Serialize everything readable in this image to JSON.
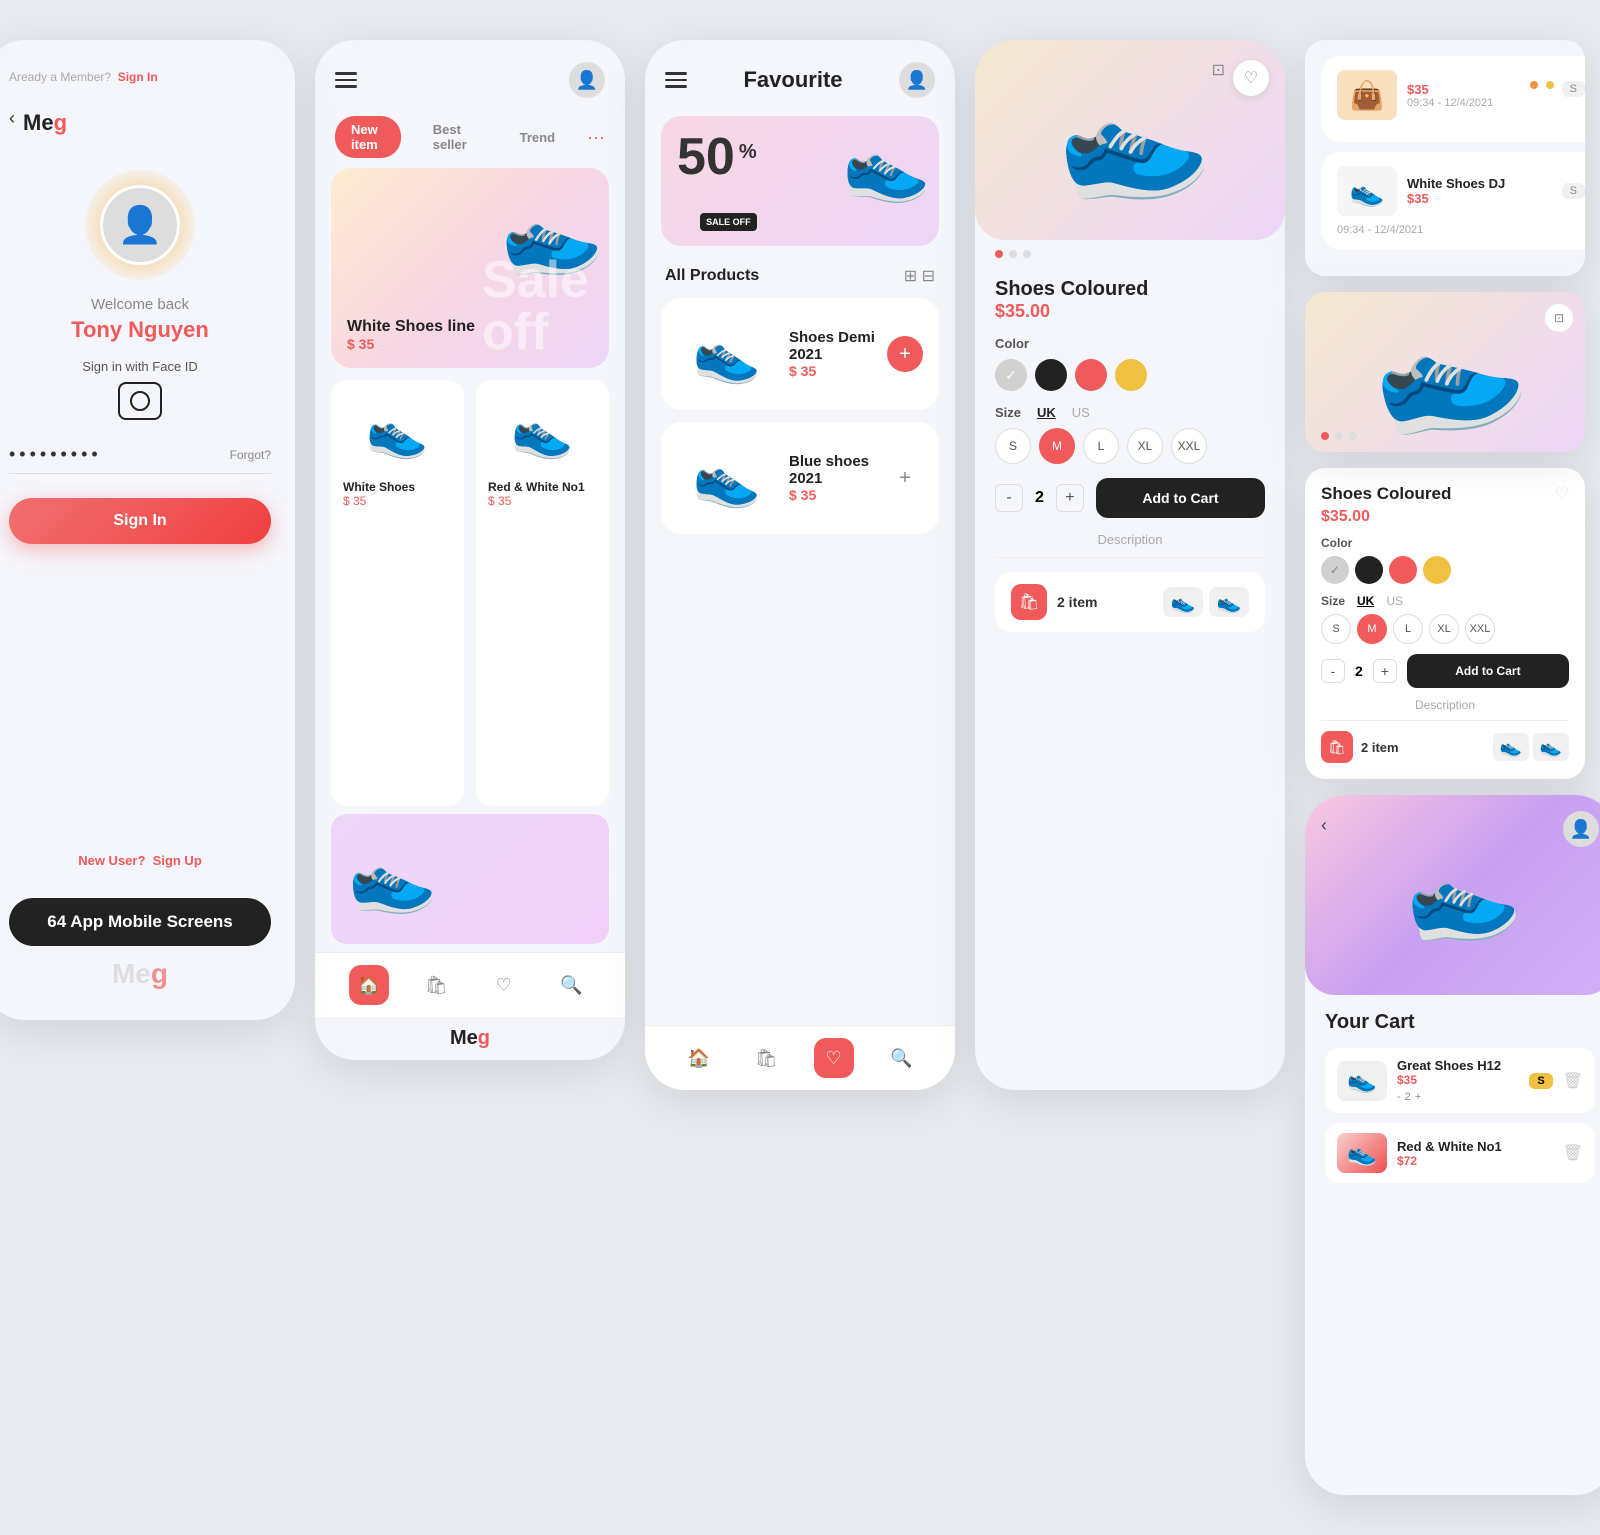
{
  "app": {
    "brand": "Meg",
    "brand_accent": "g",
    "badge_64": "64 App Mobile Screens"
  },
  "screen_login": {
    "back_icon": "‹",
    "already_member": "Aready a Member?",
    "sign_in_link": "Sign In",
    "welcome": "Welcome back",
    "user_name": "Tony Nguyen",
    "face_id_label": "Sign in with Face ID",
    "password_dots": "•••••••••",
    "forgot_label": "Forgot?",
    "signin_btn": "Sign In",
    "new_user": "New User?",
    "signup_link": "Sign Up"
  },
  "screen_shop": {
    "tabs": [
      "New item",
      "Best seller",
      "Trend"
    ],
    "active_tab": 0,
    "hero_title": "White Shoes line",
    "hero_price": "$ 35",
    "sale_overlay": "Sale off",
    "products": [
      {
        "name": "White Shoes",
        "price": "$ 35"
      },
      {
        "name": "Red & White No1",
        "price": "$ 35"
      }
    ],
    "brand_bottom": "Meg"
  },
  "screen_favourite": {
    "title": "Favourite",
    "sale_percent": "50",
    "sale_label": "SALE OFF",
    "all_products_label": "All Products",
    "products": [
      {
        "name": "Shoes Demi 2021",
        "price": "$ 35"
      },
      {
        "name": "Blue shoes 2021",
        "price": "$ 35"
      }
    ]
  },
  "screen_detail": {
    "title": "Shoes Coloured",
    "price": "$35.00",
    "color_label": "Color",
    "colors": [
      "#d0d0d0",
      "#222222",
      "#f05a5a",
      "#f0c040"
    ],
    "active_color": 0,
    "size_label": "Size",
    "size_uk": "UK",
    "size_us": "US",
    "sizes": [
      "S",
      "M",
      "L",
      "XL",
      "XXL"
    ],
    "active_size": 1,
    "qty": "2",
    "add_cart_label": "Add to Cart",
    "description_label": "Description",
    "cart_count": "2 item"
  },
  "screen_cart": {
    "title": "Your Cart",
    "items": [
      {
        "name": "Great Shoes H12",
        "price": "$35",
        "qty": "2",
        "size": "S"
      },
      {
        "name": "Red & White No1",
        "price": "$72",
        "size": ""
      }
    ]
  },
  "order_history": {
    "items": [
      {
        "name": "White Shoes DJ",
        "price": "$35",
        "size": "S",
        "time": "09:34 - 12/4/2021"
      },
      {
        "name": "Orange Bag",
        "price": "$35",
        "size": "S",
        "time": "09:34 - 12/4/2021"
      }
    ]
  },
  "partial_bottom_label": "Red White No1"
}
